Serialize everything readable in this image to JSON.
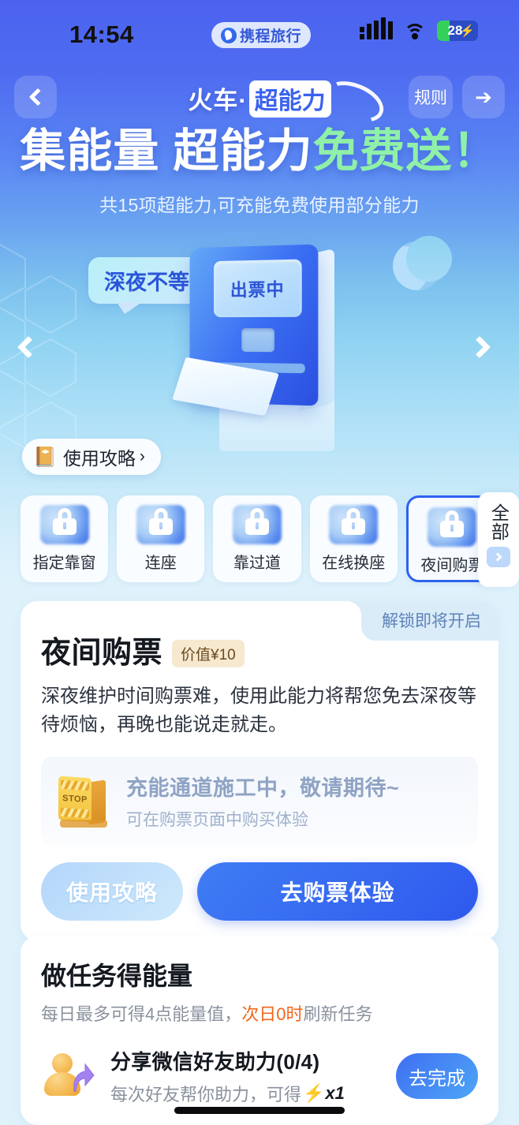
{
  "status_bar": {
    "time": "14:54",
    "app_pill_label": "携程旅行",
    "battery_level": "28"
  },
  "nav": {
    "title_main": "火车·",
    "title_badge": "超能力",
    "rules_label": "规则"
  },
  "hero": {
    "headline_white": "集能量 超能力",
    "headline_green": "免费送！",
    "subtitle": "共15项超能力,可充能免费使用部分能力"
  },
  "carousel": {
    "bubble_text": "深夜不等待",
    "machine_screen_text": "出票中",
    "guide_label": "使用攻略",
    "guide_chevron": "›"
  },
  "abilities": {
    "items": [
      {
        "label": "指定靠窗",
        "locked": true,
        "selected": false
      },
      {
        "label": "连座",
        "locked": true,
        "selected": false
      },
      {
        "label": "靠过道",
        "locked": true,
        "selected": false
      },
      {
        "label": "在线换座",
        "locked": true,
        "selected": false
      },
      {
        "label": "夜间购票",
        "locked": true,
        "selected": true
      }
    ],
    "all_label": "全部"
  },
  "detail": {
    "status_tag": "解锁即将开启",
    "title": "夜间购票",
    "value_badge": "价值¥10",
    "description": "深夜维护时间购票难，使用此能力将帮您免去深夜等待烦恼，再晚也能说走就走。",
    "notice_title": "充能通道施工中，敬请期待~",
    "notice_sub": "可在购票页面中购买体验",
    "btn_guide": "使用攻略",
    "btn_primary": "去购票体验"
  },
  "tasks": {
    "title": "做任务得能量",
    "subtitle_pre": "每日最多可得4点能量值，",
    "subtitle_highlight": "次日0时",
    "subtitle_post": "刷新任务",
    "items": [
      {
        "name": "分享微信好友助力(0/4)",
        "note_pre": "每次好友帮你助力，可得",
        "note_post": "x1",
        "action_label": "去完成"
      }
    ]
  },
  "colors": {
    "brand_blue": "#3a62ef",
    "accent_green": "#8ff0a8",
    "highlight_orange": "#f1671c",
    "badge_cream": "#f6e9cf"
  }
}
